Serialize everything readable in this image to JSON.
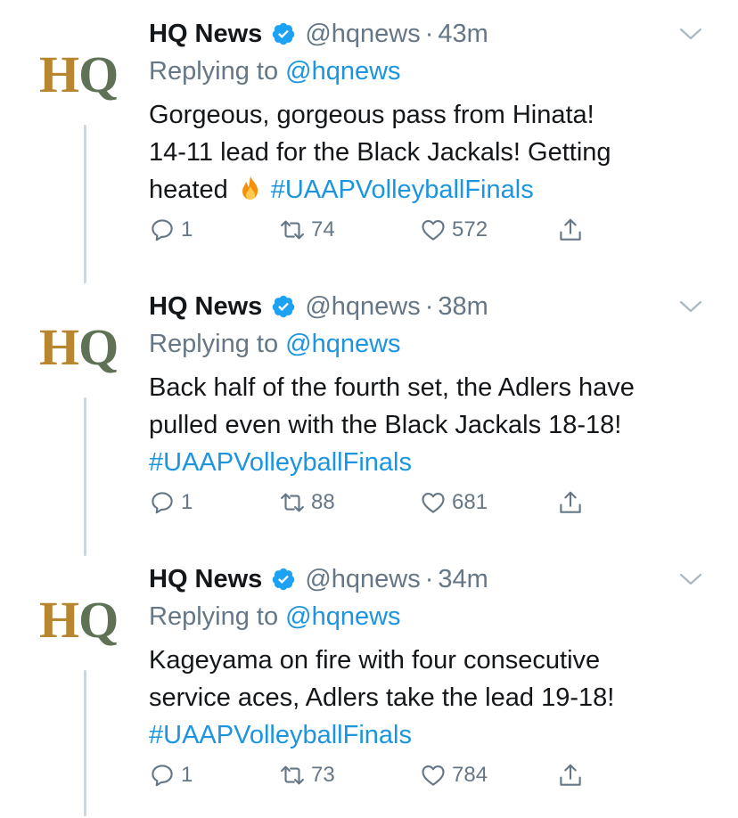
{
  "colors": {
    "link": "#1b95e0",
    "secondary": "#657786",
    "text": "#14171a",
    "avatar_h": "#b8862e",
    "avatar_q": "#5f7256"
  },
  "tweets": [
    {
      "avatar": {
        "h": "H",
        "q": "Q"
      },
      "name": "HQ News",
      "handle": "@hqnews",
      "separator": "·",
      "time": "43m",
      "replying_prefix": "Replying to ",
      "replying_to": "@hqnews",
      "text_line1": "Gorgeous, gorgeous pass from Hinata!",
      "text_line2": "14-11 lead for the Black Jackals! Getting",
      "text_line3": "heated",
      "emoji": "fire-emoji",
      "hashtag": "#UAAPVolleyballFinals",
      "replies": "1",
      "retweets": "74",
      "likes": "572"
    },
    {
      "avatar": {
        "h": "H",
        "q": "Q"
      },
      "name": "HQ News",
      "handle": "@hqnews",
      "separator": "·",
      "time": "38m",
      "replying_prefix": "Replying to ",
      "replying_to": "@hqnews",
      "text_line1": "Back half of the fourth set, the Adlers have",
      "text_line2": "pulled even with the Black Jackals 18-18!",
      "hashtag": "#UAAPVolleyballFinals",
      "replies": "1",
      "retweets": "88",
      "likes": "681"
    },
    {
      "avatar": {
        "h": "H",
        "q": "Q"
      },
      "name": "HQ News",
      "handle": "@hqnews",
      "separator": "·",
      "time": "34m",
      "replying_prefix": "Replying to ",
      "replying_to": "@hqnews",
      "text_line1": "Kageyama on fire with four consecutive",
      "text_line2": "service aces, Adlers take the lead 19-18!",
      "hashtag": "#UAAPVolleyballFinals",
      "replies": "1",
      "retweets": "73",
      "likes": "784"
    }
  ]
}
